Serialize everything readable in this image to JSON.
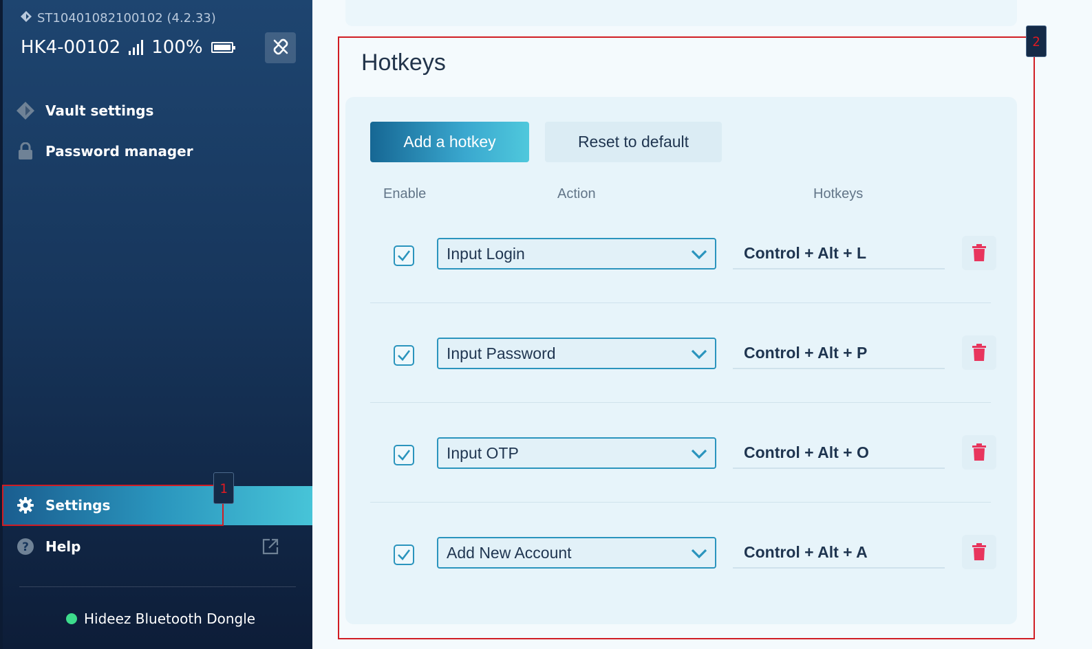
{
  "sidebar": {
    "device_id": "ST10401082100102 (4.2.33)",
    "device_name": "HK4-00102",
    "battery_percent": "100%",
    "nav": {
      "vault_settings": "Vault settings",
      "password_manager": "Password manager",
      "settings": "Settings",
      "help": "Help"
    },
    "dongle_label": "Hideez Bluetooth Dongle",
    "dongle_status_color": "#3ddc8c"
  },
  "annotations": {
    "box1": "1",
    "box2": "2"
  },
  "hotkeys": {
    "title": "Hotkeys",
    "add_button": "Add a hotkey",
    "reset_button": "Reset to default",
    "columns": {
      "enable": "Enable",
      "action": "Action",
      "hotkeys": "Hotkeys"
    },
    "rows": [
      {
        "enabled": true,
        "action": "Input Login",
        "keys": "Control + Alt + L"
      },
      {
        "enabled": true,
        "action": "Input Password",
        "keys": "Control + Alt + P"
      },
      {
        "enabled": true,
        "action": "Input OTP",
        "keys": "Control + Alt + O"
      },
      {
        "enabled": true,
        "action": "Add New Account",
        "keys": "Control + Alt + A"
      }
    ]
  },
  "colors": {
    "accent": "#2a94bd",
    "annotation": "#d01c23",
    "delete": "#e8355d"
  }
}
